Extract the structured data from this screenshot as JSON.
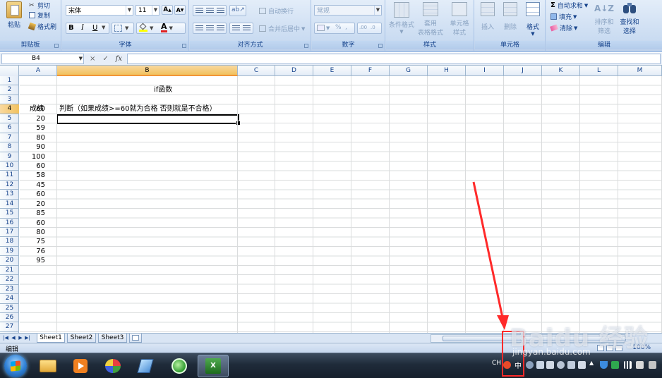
{
  "ribbon": {
    "clipboard": {
      "paste": "粘贴",
      "cut": "剪切",
      "copy": "复制",
      "format_painter": "格式刷",
      "label": "剪贴板"
    },
    "font": {
      "name": "宋体",
      "size": "11",
      "grow": "A",
      "shrink": "A",
      "bold": "B",
      "italic": "I",
      "underline": "U",
      "font_color": "A",
      "label": "字体"
    },
    "alignment": {
      "wrap": "自动换行",
      "merge": "合并后居中",
      "label": "对齐方式"
    },
    "number": {
      "format": "常规",
      "percent": "%",
      "label": "数字"
    },
    "styles": {
      "conditional": "条件格式",
      "table_format_1": "套用",
      "table_format_2": "表格格式",
      "cell_style_1": "单元格",
      "cell_style_2": "样式",
      "label": "样式"
    },
    "cells": {
      "insert": "插入",
      "delete": "删除",
      "format": "格式",
      "label": "单元格"
    },
    "editing": {
      "autosum": "自动求和",
      "fill": "填充",
      "clear": "清除",
      "sort_1": "排序和",
      "sort_2": "筛选",
      "find_1": "查找和",
      "find_2": "选择",
      "label": "编辑"
    }
  },
  "formula_bar": {
    "name_box": "B4",
    "cancel": "×",
    "enter": "✓",
    "fx": "fx",
    "value": ""
  },
  "columns": [
    "A",
    "B",
    "C",
    "D",
    "E",
    "F",
    "G",
    "H",
    "I",
    "J",
    "K",
    "L",
    "M"
  ],
  "selected_column": "B",
  "rows": [
    "1",
    "2",
    "3",
    "4",
    "5",
    "6",
    "7",
    "8",
    "9",
    "10",
    "11",
    "12",
    "13",
    "14",
    "15",
    "16",
    "17",
    "18",
    "19",
    "20",
    "21",
    "22",
    "23",
    "24",
    "25",
    "26",
    "27"
  ],
  "selected_row": "4",
  "cells": {
    "b1": "if函数",
    "a3": "成绩",
    "b3": "判断（如果成绩>=60就为合格 否则就是不合格）",
    "scores": [
      "60",
      "20",
      "59",
      "80",
      "90",
      "100",
      "60",
      "58",
      "45",
      "60",
      "20",
      "85",
      "60",
      "80",
      "75",
      "76",
      "95"
    ]
  },
  "sheets": [
    "Sheet1",
    "Sheet2",
    "Sheet3"
  ],
  "active_sheet": "Sheet1",
  "status": {
    "mode": "编辑",
    "zoom": "100%"
  },
  "taskbar": {
    "lang": "CH",
    "ime": "中"
  },
  "watermark": {
    "text": "Baidu 经验",
    "sub": "jingyan.baidu.com"
  },
  "colors": {
    "accent": "#f29536",
    "annotation": "#ff2a2a"
  }
}
